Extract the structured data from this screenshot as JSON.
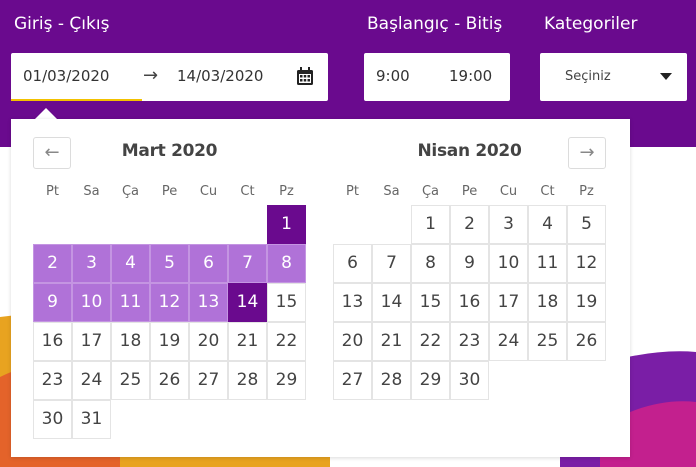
{
  "header": {
    "checkin_checkout_label": "Giriş - Çıkış",
    "start_end_label": "Başlangıç - Bitiş",
    "categories_label": "Kategoriler"
  },
  "date_range": {
    "start_value": "01/03/2020",
    "arrow": "→",
    "end_value": "14/03/2020",
    "icon": "calendar-icon"
  },
  "time_range": {
    "start_value": "9:00",
    "end_value": "19:00"
  },
  "category": {
    "selected": "Seçiniz",
    "icon": "caret-down-icon"
  },
  "calendar": {
    "prev_label": "←",
    "next_label": "→",
    "weekdays": [
      "Pt",
      "Sa",
      "Ça",
      "Pe",
      "Cu",
      "Ct",
      "Pz"
    ],
    "colors": {
      "endpoint": "#6a0a8e",
      "in_range": "#b072d8",
      "header_bg": "#6a0a8e"
    },
    "months": [
      {
        "title": "Mart 2020",
        "first_weekday_index": 6,
        "days": 31,
        "selected_start": 1,
        "selected_end": 14,
        "day_labels": [
          "1",
          "2",
          "3",
          "4",
          "5",
          "6",
          "7",
          "8",
          "9",
          "10",
          "11",
          "12",
          "13",
          "14",
          "15",
          "16",
          "17",
          "18",
          "19",
          "20",
          "21",
          "22",
          "23",
          "24",
          "25",
          "26",
          "27",
          "28",
          "29",
          "30",
          "31"
        ]
      },
      {
        "title": "Nisan 2020",
        "first_weekday_index": 2,
        "days": 30,
        "selected_start": null,
        "selected_end": null,
        "day_labels": [
          "1",
          "2",
          "3",
          "4",
          "5",
          "6",
          "7",
          "8",
          "9",
          "10",
          "11",
          "12",
          "13",
          "14",
          "15",
          "16",
          "17",
          "18",
          "19",
          "20",
          "21",
          "22",
          "23",
          "24",
          "25",
          "26",
          "27",
          "28",
          "29",
          "30"
        ]
      }
    ]
  }
}
